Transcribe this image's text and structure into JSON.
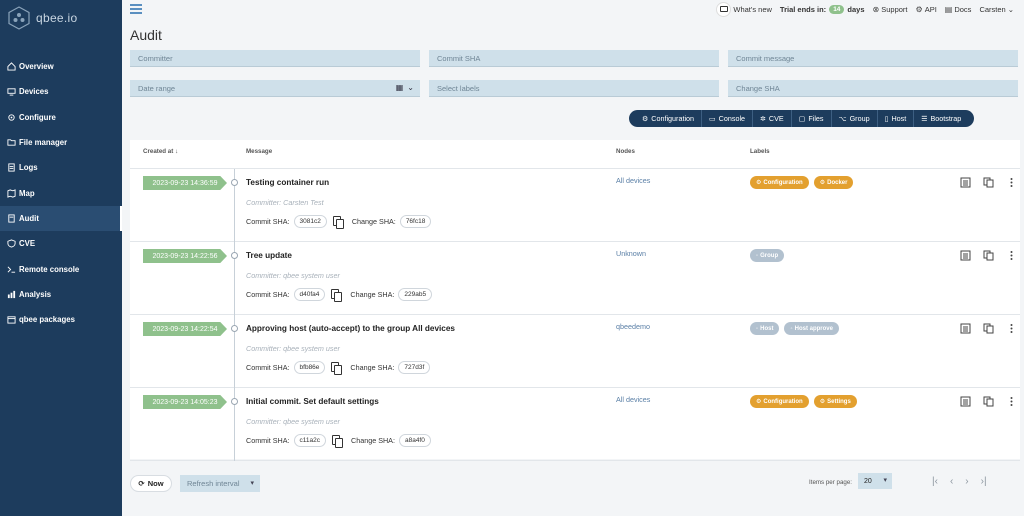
{
  "brand": {
    "name": "qbee.io"
  },
  "sidebar": {
    "items": [
      {
        "label": "Overview",
        "icon": "home-icon"
      },
      {
        "label": "Devices",
        "icon": "devices-icon"
      },
      {
        "label": "Configure",
        "icon": "configure-icon"
      },
      {
        "label": "File manager",
        "icon": "file-manager-icon"
      },
      {
        "label": "Logs",
        "icon": "logs-icon"
      },
      {
        "label": "Map",
        "icon": "map-icon"
      },
      {
        "label": "Audit",
        "icon": "audit-icon",
        "active": true
      },
      {
        "label": "CVE",
        "icon": "shield-icon"
      },
      {
        "label": "Remote console",
        "icon": "terminal-icon"
      },
      {
        "label": "Analysis",
        "icon": "analysis-icon"
      },
      {
        "label": "qbee packages",
        "icon": "package-icon"
      }
    ]
  },
  "topbar": {
    "whats_new": "What's new",
    "trial_prefix": "Trial ends in:",
    "trial_days_value": "14",
    "trial_suffix": "days",
    "support": "Support",
    "api": "API",
    "docs": "Docs",
    "user": "Carsten"
  },
  "page": {
    "title": "Audit"
  },
  "filters": {
    "committer": "Committer",
    "commit_sha": "Commit SHA",
    "commit_message": "Commit message",
    "date_range": "Date range",
    "select_labels": "Select labels",
    "change_sha": "Change SHA"
  },
  "tabs": [
    {
      "label": "Configuration",
      "icon": "gear-icon"
    },
    {
      "label": "Console",
      "icon": "console-icon"
    },
    {
      "label": "CVE",
      "icon": "cve-icon"
    },
    {
      "label": "Files",
      "icon": "files-icon"
    },
    {
      "label": "Group",
      "icon": "group-icon"
    },
    {
      "label": "Host",
      "icon": "host-icon"
    },
    {
      "label": "Bootstrap",
      "icon": "bootstrap-icon"
    }
  ],
  "table": {
    "headers": {
      "created_at": "Created at",
      "message": "Message",
      "nodes": "Nodes",
      "labels": "Labels"
    },
    "commit_sha_label": "Commit SHA:",
    "change_sha_label": "Change SHA:",
    "rows": [
      {
        "date": "2023-09-23 14:36:59",
        "message": "Testing container run",
        "committer": "Committer: Carsten Test",
        "commit_sha": "3081c2",
        "change_sha": "76fc18",
        "nodes": "All devices",
        "labels": [
          {
            "text": "Configuration",
            "color": "orange"
          },
          {
            "text": "Docker",
            "color": "orange"
          }
        ]
      },
      {
        "date": "2023-09-23 14:22:56",
        "message": "Tree update",
        "committer": "Committer: qbee system user",
        "commit_sha": "d40fa4",
        "change_sha": "229ab5",
        "nodes": "Unknown",
        "labels": [
          {
            "text": "Group",
            "color": "gray"
          }
        ]
      },
      {
        "date": "2023-09-23 14:22:54",
        "message": "Approving host (auto-accept) to the group All devices",
        "committer": "Committer: qbee system user",
        "commit_sha": "bfb86e",
        "change_sha": "727d3f",
        "nodes": "qbeedemo",
        "labels": [
          {
            "text": "Host",
            "color": "gray"
          },
          {
            "text": "Host approve",
            "color": "gray"
          }
        ]
      },
      {
        "date": "2023-09-23 14:05:23",
        "message": "Initial commit. Set default settings",
        "committer": "Committer: qbee system user",
        "commit_sha": "c11a2c",
        "change_sha": "a8a4f0",
        "nodes": "All devices",
        "labels": [
          {
            "text": "Configuration",
            "color": "orange"
          },
          {
            "text": "Settings",
            "color": "orange"
          }
        ]
      }
    ]
  },
  "footer": {
    "now": "Now",
    "refresh_interval": "Refresh interval",
    "items_per_page_label": "Items per page:",
    "items_per_page_value": "20"
  },
  "colors": {
    "sidebar_bg": "#1d3c5d",
    "date_tag": "#8fc18c",
    "label_orange": "#e3a02f",
    "label_gray": "#b2c1cf",
    "filter_bg": "#cfe0ea"
  }
}
